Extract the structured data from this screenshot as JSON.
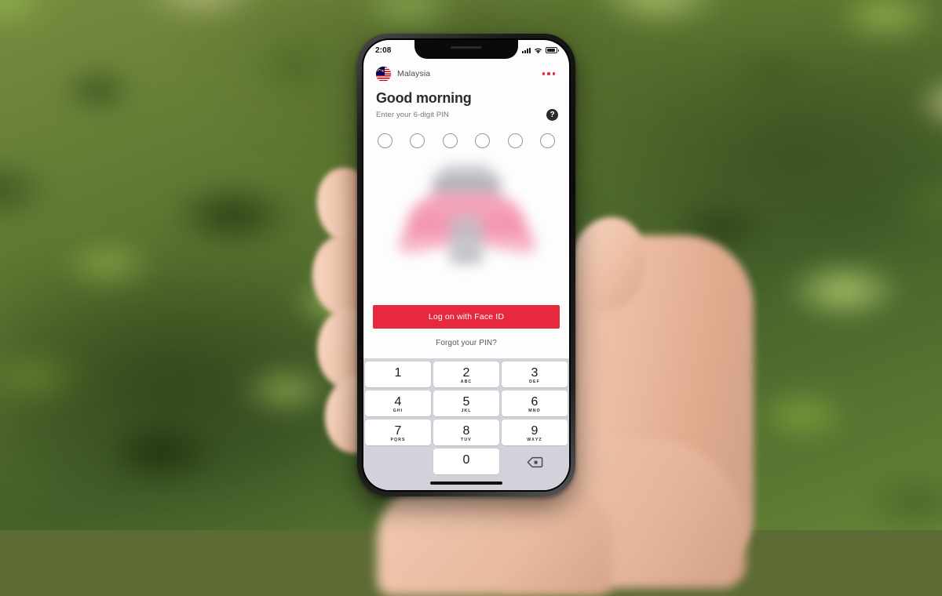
{
  "scene": {
    "description": "hand-holding-phone-outdoors",
    "background": "blurred-grass"
  },
  "phone": {
    "status_bar": {
      "time": "2:08",
      "icons": [
        "signal-bars-icon",
        "wifi-icon",
        "battery-icon"
      ]
    },
    "app_header": {
      "flag_icon": "malaysia-flag-icon",
      "region_label": "Malaysia",
      "more_menu_icon": "more-options-icon"
    },
    "greeting": {
      "title": "Good morning",
      "subtitle": "Enter your 6-digit PIN",
      "help_icon_label": "?"
    },
    "pin": {
      "length": 6,
      "dots": [
        "",
        "",
        "",
        "",
        "",
        ""
      ]
    },
    "cta": {
      "faceid_label": "Log on with Face ID",
      "forgot_label": "Forgot your PIN?"
    },
    "keypad": {
      "keys": [
        {
          "num": "1",
          "alpha": ""
        },
        {
          "num": "2",
          "alpha": "ABC"
        },
        {
          "num": "3",
          "alpha": "DEF"
        },
        {
          "num": "4",
          "alpha": "GHI"
        },
        {
          "num": "5",
          "alpha": "JKL"
        },
        {
          "num": "6",
          "alpha": "MNO"
        },
        {
          "num": "7",
          "alpha": "PQRS"
        },
        {
          "num": "8",
          "alpha": "TUV"
        },
        {
          "num": "9",
          "alpha": "WXYZ"
        },
        {
          "num": "0",
          "alpha": ""
        }
      ],
      "delete_icon": "backspace-icon"
    },
    "colors": {
      "accent_red": "#e8283c",
      "keypad_bg": "#d2d2da",
      "key_bg": "#ffffff",
      "screen_bg": "#fdfdfd",
      "text_dark": "#2b2b30",
      "text_muted": "#77777e"
    }
  }
}
